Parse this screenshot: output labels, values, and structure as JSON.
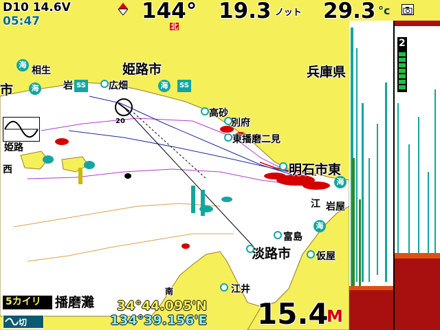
{
  "header": {
    "voltage": "D10 14.6V",
    "clock": "05:47",
    "heading": "144°",
    "speed": "19.3",
    "speed_unit": "ノット",
    "temperature": "29.3",
    "temperature_unit": "°c",
    "north_marker": "北"
  },
  "chart": {
    "places": [
      {
        "name": "姫路市",
        "cls": "big"
      },
      {
        "name": "兵庫県",
        "cls": "big"
      },
      {
        "name": "相生",
        "cls": ""
      },
      {
        "name": "市",
        "cls": "big"
      },
      {
        "name": "岩",
        "cls": ""
      },
      {
        "name": "広畑",
        "cls": ""
      },
      {
        "name": "高砂",
        "cls": ""
      },
      {
        "name": "別府",
        "cls": ""
      },
      {
        "name": "東播磨二見",
        "cls": ""
      },
      {
        "name": "明石市東",
        "cls": "big"
      },
      {
        "name": "江",
        "cls": ""
      },
      {
        "name": "岩屋",
        "cls": ""
      },
      {
        "name": "富島",
        "cls": ""
      },
      {
        "name": "淡路市",
        "cls": "big"
      },
      {
        "name": "仮屋",
        "cls": ""
      },
      {
        "name": "江井",
        "cls": ""
      },
      {
        "name": "姫路",
        "cls": ""
      },
      {
        "name": "西",
        "cls": ""
      }
    ],
    "port_icon": "海",
    "ss_icon": "SS",
    "south_marker": "南",
    "waypoint_number": "20"
  },
  "footer": {
    "scale": "5カイリ",
    "area_name": "播磨灘",
    "latitude": "34°44.095'N",
    "longitude": "134°39.156'E",
    "depth": "15.4",
    "depth_unit": "M",
    "toggle_label": "切"
  },
  "sonar": {
    "gain_level": "2"
  },
  "colors": {
    "land": "#f5ef5a",
    "sea": "#ffffff",
    "accent": "#13a6a0",
    "track_red": "#d40000"
  }
}
